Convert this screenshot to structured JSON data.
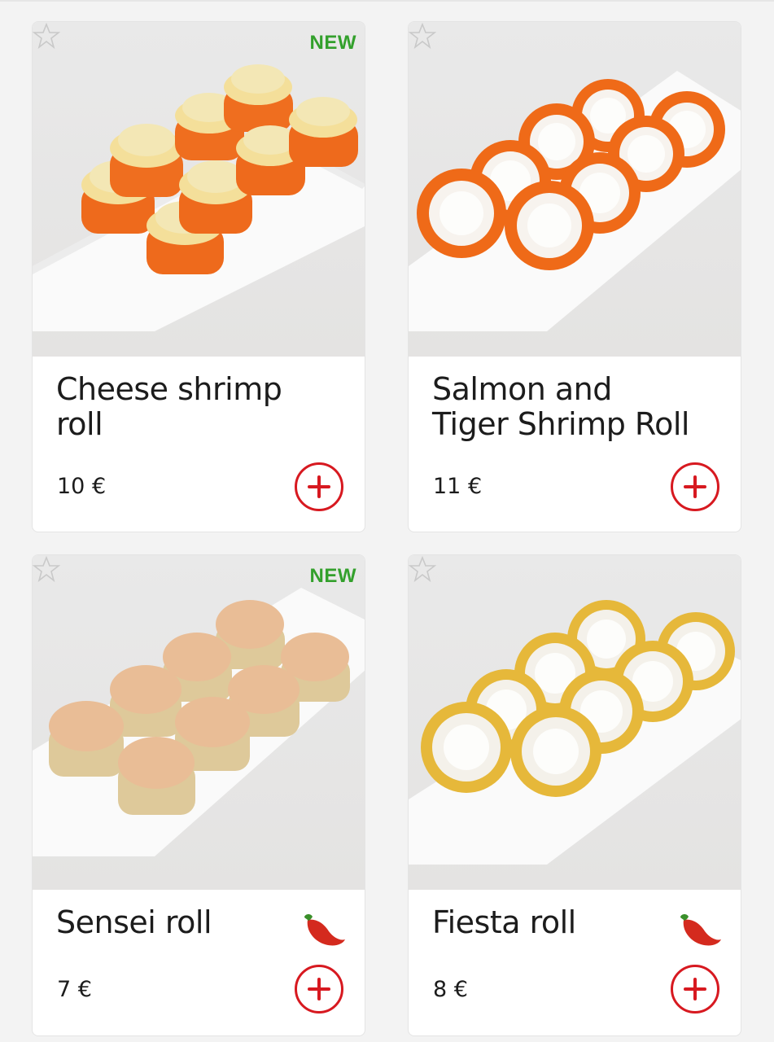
{
  "products": [
    {
      "name": "Cheese shrimp roll",
      "price": "10 €",
      "badge": "NEW",
      "spicy": false
    },
    {
      "name": "Salmon and Tiger Shrimp Roll",
      "price": "11 €",
      "badge": "",
      "spicy": false
    },
    {
      "name": "Sensei roll",
      "price": "7 €",
      "badge": "NEW",
      "spicy": true
    },
    {
      "name": "Fiesta roll",
      "price": "8 €",
      "badge": "",
      "spicy": true
    }
  ],
  "colors": {
    "accent": "#d71920",
    "new_badge": "#33a02c",
    "background": "#f3f3f3"
  },
  "icons": {
    "favorite": "star-outline-icon",
    "add": "plus-circle-icon",
    "spicy": "chili-pepper-icon"
  }
}
